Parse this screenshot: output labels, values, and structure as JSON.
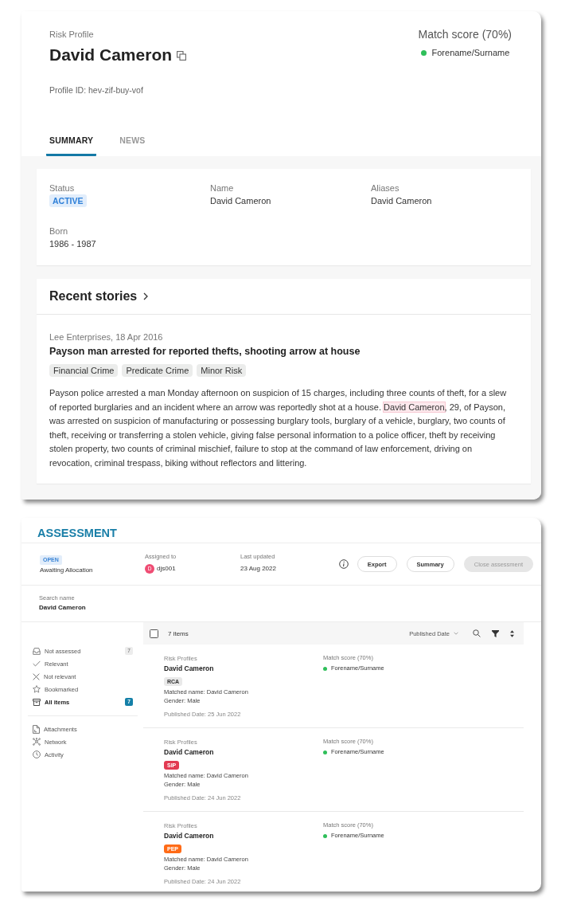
{
  "profile": {
    "type_label": "Risk Profile",
    "name": "David Cameron",
    "profile_id": "Profile ID: hev-zif-buy-vof",
    "match_score": "Match score (70%)",
    "match_criteria": [
      {
        "label": "Forename/Surname",
        "color": "#2fbf5a"
      }
    ]
  },
  "tabs": [
    {
      "label": "SUMMARY",
      "selected": true
    },
    {
      "label": "NEWS",
      "selected": false
    }
  ],
  "summary": {
    "fields": [
      {
        "label": "Status",
        "value": "ACTIVE",
        "kind": "badge"
      },
      {
        "label": "Name",
        "value": "David Cameron",
        "kind": "text"
      },
      {
        "label": "Aliases",
        "value": "David Cameron",
        "kind": "text"
      },
      {
        "label": "Born",
        "value": "1986 - 1987",
        "kind": "text"
      }
    ]
  },
  "recent_stories": {
    "title": "Recent stories",
    "stories": [
      {
        "source": "Lee Enterprises, 18 Apr 2016",
        "headline": "Payson man arrested for reported thefts, shooting arrow at house",
        "tags": [
          "Financial Crime",
          "Predicate Crime",
          "Minor Risk"
        ],
        "body": [
          {
            "text": "Payson police arrested a man Monday afternoon on suspicion of 15 charges, including three counts of theft, for a slew of reported burglaries and an incident where an arrow was reportedly shot at a house. ",
            "highlight": false
          },
          {
            "text": "David Cameron",
            "highlight": true
          },
          {
            "text": ", 29, of Payson, was arrested on suspicion of manufacturing or possessing burglary tools, burglary of a vehicle, burglary, two counts of theft, receiving or transferring a stolen vehicle, giving false personal information to a police officer, theft by receiving stolen property, two counts of criminal mischief, failure to stop at the command of law enforcement, driving on revocation, criminal trespass, biking without reflectors and littering.",
            "highlight": false
          }
        ]
      }
    ]
  },
  "assessment": {
    "title": "ASSESSMENT",
    "status": {
      "badge": "OPEN",
      "text": "Awaiting Allocation"
    },
    "assigned_to": {
      "label": "Assigned to",
      "initial": "D",
      "user": "djs001"
    },
    "last_updated": {
      "label": "Last updated",
      "value": "23 Aug 2022"
    },
    "actions": [
      {
        "label": "Export",
        "disabled": false
      },
      {
        "label": "Summary",
        "disabled": false
      },
      {
        "label": "Close assessment",
        "disabled": true
      }
    ],
    "search_name": {
      "label": "Search name",
      "value": "David Cameron"
    }
  },
  "sidebar": {
    "filters": [
      {
        "label": "Not assessed",
        "count": "7",
        "selected": false
      },
      {
        "label": "Relevant",
        "selected": false
      },
      {
        "label": "Not relevant",
        "selected": false
      },
      {
        "label": "Bookmarked",
        "selected": false
      },
      {
        "label": "All items",
        "count": "7",
        "selected": true
      }
    ],
    "sections": [
      {
        "label": "Attachments",
        "selected": false
      },
      {
        "label": "Network",
        "selected": false
      },
      {
        "label": "Activity",
        "selected": false
      }
    ]
  },
  "results": {
    "select_all": {
      "checked": false
    },
    "count": "7 items",
    "sort": "Published Date",
    "items": [
      {
        "category": "Risk Profiles",
        "name": "David Cameron",
        "tag": {
          "label": "RCA",
          "color": "#e9e9e9"
        },
        "matched_name": "Matched name: David Cameron",
        "gender": "Gender: Male",
        "published": "Published Date: 25 Jun 2022",
        "match_score": "Match score (70%)",
        "match_criteria": [
          {
            "label": "Forename/Surname",
            "color": "#2fbf5a"
          }
        ]
      },
      {
        "category": "Risk Profiles",
        "name": "David Cameron",
        "tag": {
          "label": "SIP",
          "color": "#e23a52"
        },
        "matched_name": "Matched name: David Cameron",
        "gender": "Gender: Male",
        "published": "Published Date: 24 Jun 2022",
        "match_score": "Match score (70%)",
        "match_criteria": [
          {
            "label": "Forename/Surname",
            "color": "#2fbf5a"
          }
        ]
      },
      {
        "category": "Risk Profiles",
        "name": "David Cameron",
        "tag": {
          "label": "PEP",
          "color": "#ff6b17"
        },
        "matched_name": "Matched name: David Cameron",
        "gender": "Gender: Male",
        "published": "Published Date: 24 Jun 2022",
        "match_score": "Match score (70%)",
        "match_criteria": [
          {
            "label": "Forename/Surname",
            "color": "#2fbf5a"
          }
        ]
      }
    ]
  }
}
